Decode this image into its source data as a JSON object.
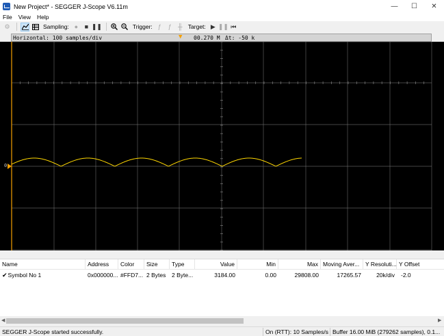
{
  "window": {
    "title": "New Project* - SEGGER J-Scope V6.11m",
    "minimize": "—",
    "maximize": "☐",
    "close": "✕"
  },
  "menu": [
    "File",
    "View",
    "Help"
  ],
  "toolbar": {
    "sampling_label": "Sampling:",
    "trigger_label": "Trigger:",
    "target_label": "Target:"
  },
  "scope": {
    "horizontal": "Horizontal: 100 samples/div",
    "cursor_value": "00.270 M",
    "delta_t": "Δt: -50 k",
    "zero_label": "0",
    "trace_color": "#FFD700",
    "background": "#000000",
    "grid_color": "#808080"
  },
  "table": {
    "columns": [
      "Name",
      "Address",
      "Color",
      "Size",
      "Type",
      "Value",
      "Min",
      "Max",
      "Moving Aver...",
      "Y Resoluti...",
      "Y Offset"
    ],
    "rows": [
      {
        "name": "Symbol No 1",
        "address": "0x000000...",
        "color": "#FFD7...",
        "size": "2 Bytes",
        "type": "2 Byte...",
        "value": "3184.00",
        "min": "0.00",
        "max": "29808.00",
        "moving_average": "17265.57",
        "y_resolution": "20k/div",
        "y_offset": "-2.0"
      }
    ]
  },
  "status": {
    "message": "SEGGER J-Scope started successfully.",
    "rtt": "On (RTT): 10 Samples/s",
    "buffer": "Buffer 16.00 MiB (279262 samples), 0.1..."
  }
}
